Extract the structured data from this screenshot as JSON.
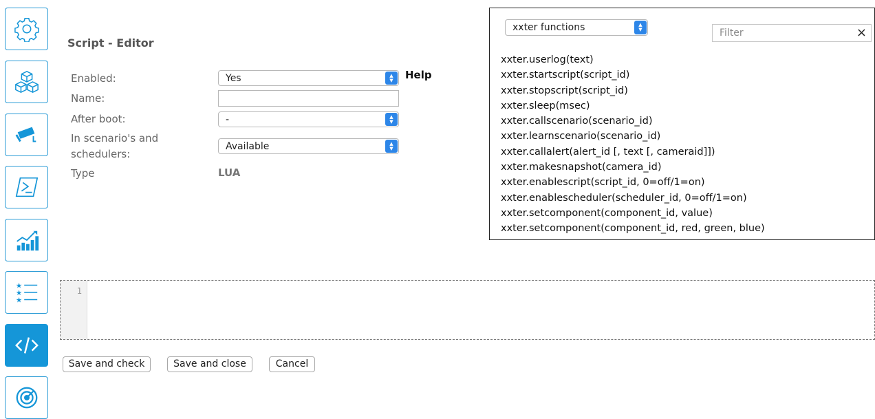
{
  "page_title": "Script - Editor",
  "form": {
    "enabled_label": "Enabled:",
    "enabled_value": "Yes",
    "name_label": "Name:",
    "name_value": "",
    "after_boot_label": "After boot:",
    "after_boot_value": "-",
    "scenarios_label_line1": "In scenario's and",
    "scenarios_label_line2": "schedulers:",
    "scenarios_value": "Available",
    "type_label": "Type",
    "type_value": "LUA",
    "help_link": "Help"
  },
  "help_panel": {
    "category_value": "xxter functions",
    "filter_placeholder": "Filter",
    "filter_value": "",
    "clear_icon": "×",
    "functions": [
      "xxter.userlog(text)",
      "xxter.startscript(script_id)",
      "xxter.stopscript(script_id)",
      "xxter.sleep(msec)",
      "xxter.callscenario(scenario_id)",
      "xxter.learnscenario(scenario_id)",
      "xxter.callalert(alert_id [, text [, cameraid]])",
      "xxter.makesnapshot(camera_id)",
      "xxter.enablescript(script_id, 0=off/1=on)",
      "xxter.enablescheduler(scheduler_id, 0=off/1=on)",
      "xxter.setcomponent(component_id, value)",
      "xxter.setcomponent(component_id, red, green, blue)"
    ]
  },
  "editor": {
    "line_number": "1"
  },
  "buttons": {
    "save_check": "Save and check",
    "save_close": "Save and close",
    "cancel": "Cancel"
  },
  "sidebar": {
    "items": [
      {
        "icon": "gear-icon",
        "active": false
      },
      {
        "icon": "cubes-icon",
        "active": false
      },
      {
        "icon": "camera-icon",
        "active": false
      },
      {
        "icon": "terminal-icon",
        "active": false
      },
      {
        "icon": "chart-icon",
        "active": false
      },
      {
        "icon": "star-list-icon",
        "active": false
      },
      {
        "icon": "code-icon",
        "active": true
      },
      {
        "icon": "radar-icon",
        "active": false
      }
    ]
  },
  "colors": {
    "accent": "#1596d8",
    "select_arrow": "#2d86e8"
  }
}
